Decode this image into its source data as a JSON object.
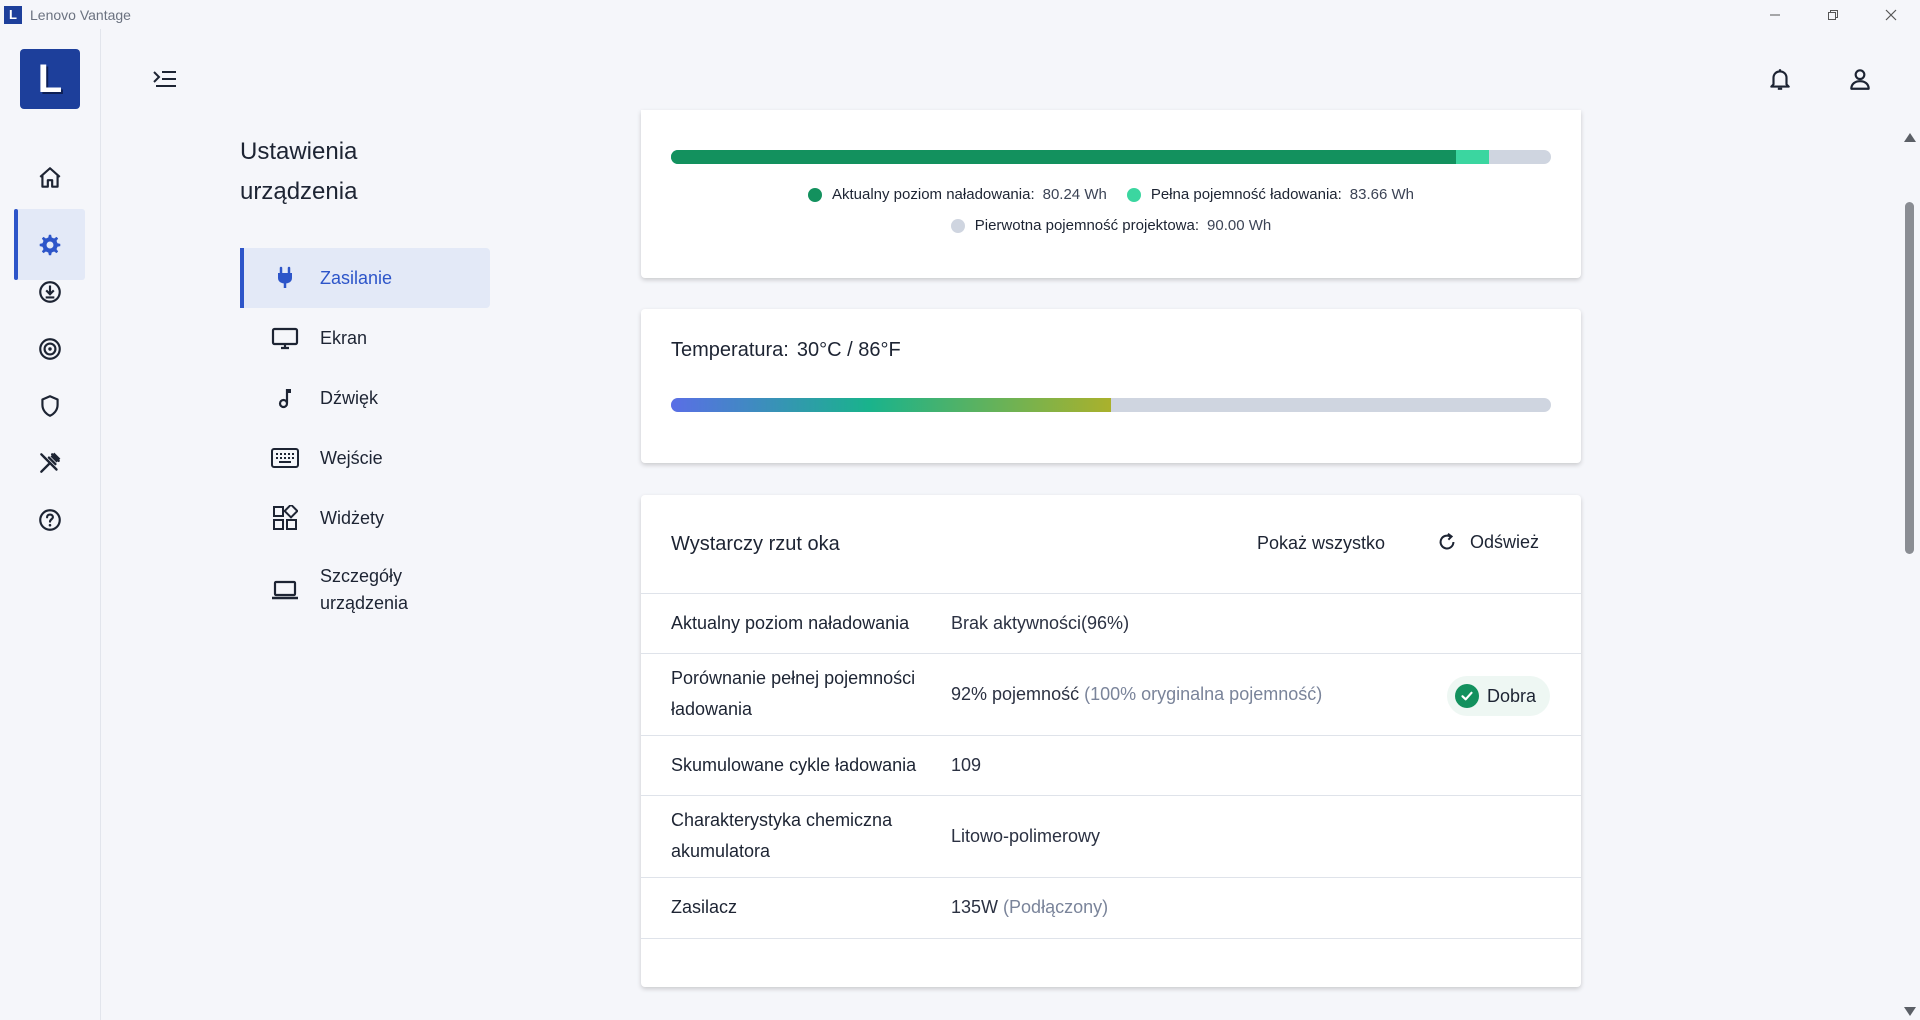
{
  "titlebar": {
    "app_title": "Lenovo Vantage",
    "logo_letter": "L"
  },
  "rail": {
    "brand_letter": "L",
    "items": [
      {
        "icon": "home-icon"
      },
      {
        "icon": "gear-icon",
        "active": true
      },
      {
        "icon": "download-icon"
      },
      {
        "icon": "radar-icon"
      },
      {
        "icon": "shield-icon"
      },
      {
        "icon": "tools-icon"
      },
      {
        "icon": "help-icon"
      }
    ]
  },
  "section": {
    "title_line1": "Ustawienia",
    "title_line2": "urządzenia"
  },
  "subnav": [
    {
      "label": "Zasilanie",
      "icon": "plug-icon",
      "active": true
    },
    {
      "label": "Ekran",
      "icon": "monitor-icon"
    },
    {
      "label": "Dźwięk",
      "icon": "music-note-icon"
    },
    {
      "label": "Wejście",
      "icon": "keyboard-icon"
    },
    {
      "label": "Widżety",
      "icon": "widgets-icon"
    },
    {
      "label_line1": "Szczegóły",
      "label_line2": "urządzenia",
      "icon": "laptop-icon"
    }
  ],
  "battery": {
    "current_label": "Aktualny poziom naładowania:",
    "current_value": "80.24 Wh",
    "full_label": "Pełna pojemność ładowania:",
    "full_value": "83.66 Wh",
    "design_label": "Pierwotna pojemność projektowa:",
    "design_value": "90.00 Wh",
    "current_fraction": 0.8916,
    "full_fraction": 0.9296,
    "colors": {
      "current": "#13915e",
      "full": "#3bd6a0",
      "design": "#cfd5e0"
    }
  },
  "temperature": {
    "label": "Temperatura:",
    "value": "30°C / 86°F",
    "fraction": 0.5
  },
  "glance": {
    "title": "Wystarczy rzut oka",
    "show_all": "Pokaż wszystko",
    "refresh": "Odśwież",
    "rows": [
      {
        "key": "Aktualny poziom naładowania",
        "value": "Brak aktywności(96%)",
        "extra": ""
      },
      {
        "key": "Porównanie pełnej pojemności ładowania",
        "value": "92% pojemność",
        "extra": "(100% oryginalna pojemność)",
        "badge": "Dobra"
      },
      {
        "key": "Skumulowane cykle ładowania",
        "value": "109",
        "extra": ""
      },
      {
        "key": "Charakterystyka chemiczna akumulatora",
        "value": "Litowo-polimerowy",
        "extra": ""
      },
      {
        "key": "Zasilacz",
        "value": "135W",
        "extra": "(Podłączony)"
      }
    ]
  }
}
